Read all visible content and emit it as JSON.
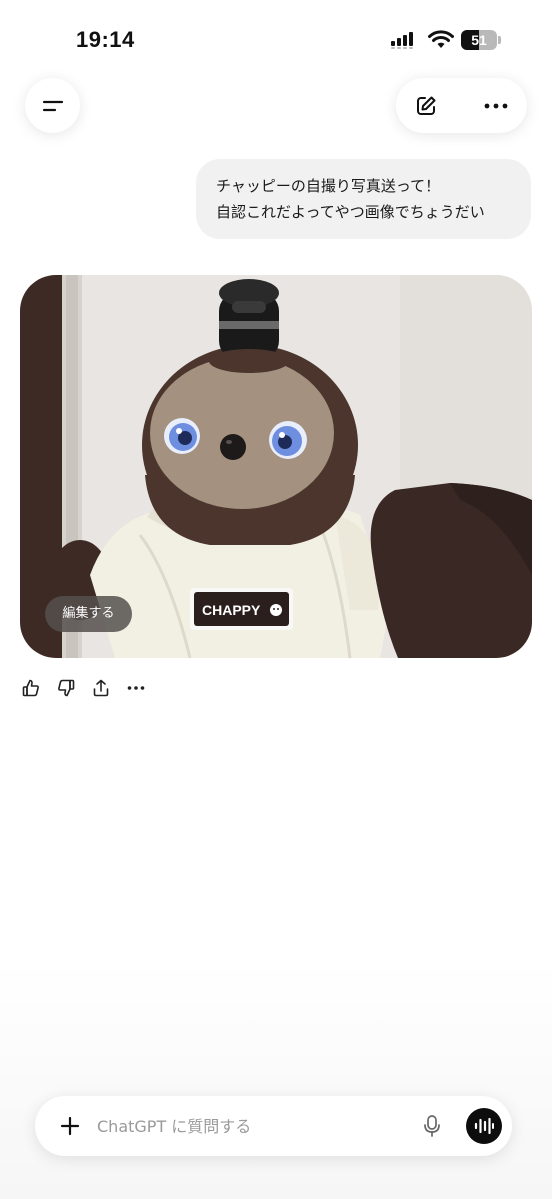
{
  "status_bar": {
    "time": "19:14",
    "battery_level": "51",
    "battery_fraction": 0.51,
    "signal_icon": "cellular-signal-icon",
    "wifi_icon": "wifi-icon"
  },
  "header": {
    "menu_icon": "menu-icon",
    "new_chat_icon": "edit-pencil-icon",
    "more_icon": "more-horizontal-icon"
  },
  "conversation": {
    "user_message": {
      "lines": [
        "チャッピーの自撮り写真送って！",
        "自認これだよってやつ画像でちょうだい"
      ]
    },
    "assistant_image": {
      "badge_text": "CHAPPY",
      "edit_label": "編集する"
    },
    "actions": [
      {
        "name": "thumbs-up-icon"
      },
      {
        "name": "thumbs-down-icon"
      },
      {
        "name": "share-icon"
      },
      {
        "name": "more-horizontal-icon"
      }
    ]
  },
  "composer": {
    "placeholder": "ChatGPT に質問する",
    "value": "",
    "plus_icon": "plus-icon",
    "mic_icon": "microphone-icon",
    "voice_icon": "voice-mode-icon"
  },
  "colors": {
    "bubble_bg": "#f1f1f1",
    "robot_brown": "#4b352d",
    "robot_face": "#a4917f",
    "eye_blue": "#6e8fe0",
    "shirt": "#f2efe2",
    "voice_button": "#0d0d0d"
  }
}
